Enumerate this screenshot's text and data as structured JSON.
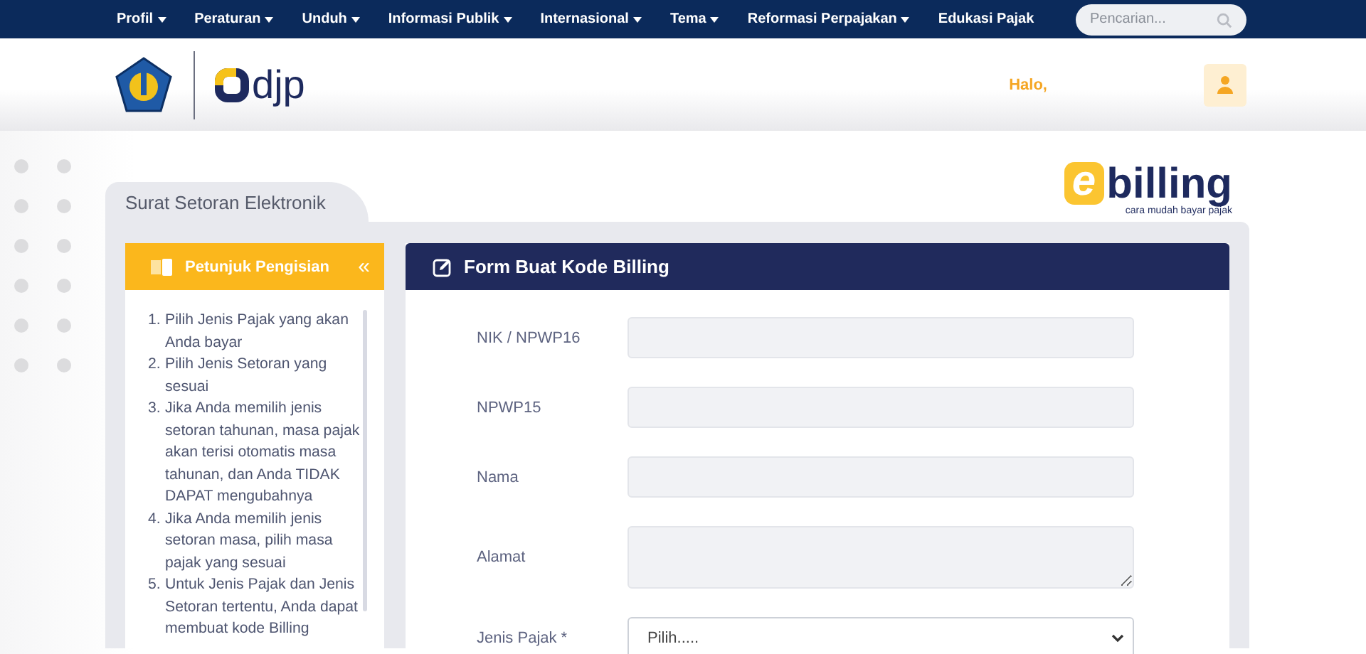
{
  "nav": {
    "items": [
      {
        "label": "Profil",
        "dropdown": true
      },
      {
        "label": "Peraturan",
        "dropdown": true
      },
      {
        "label": "Unduh",
        "dropdown": true
      },
      {
        "label": "Informasi Publik",
        "dropdown": true
      },
      {
        "label": "Internasional",
        "dropdown": true
      },
      {
        "label": "Tema",
        "dropdown": true
      },
      {
        "label": "Reformasi Perpajakan",
        "dropdown": true
      },
      {
        "label": "Edukasi Pajak",
        "dropdown": false
      }
    ],
    "search": {
      "placeholder": "Pencarian..."
    }
  },
  "header": {
    "logo_text": "djp",
    "greeting": "Halo,"
  },
  "ebilling_logo": {
    "letter": "e",
    "word": "billing",
    "tagline": "cara mudah bayar pajak"
  },
  "page_tab": "Surat Setoran Elektronik",
  "guide": {
    "title": "Petunjuk Pengisian",
    "collapse": "«",
    "steps": [
      {
        "number": "1.",
        "text": "Pilih Jenis Pajak yang akan Anda bayar"
      },
      {
        "number": "2.",
        "text": "Pilih Jenis Setoran yang sesuai"
      },
      {
        "number": "3.",
        "text": "Jika Anda memilih jenis setoran tahunan, masa pajak akan terisi otomatis masa tahunan, dan Anda TIDAK DAPAT mengubahnya"
      },
      {
        "number": "4.",
        "text": "Jika Anda memilih jenis setoran masa, pilih masa pajak yang sesuai"
      },
      {
        "number": "5.",
        "text": "Untuk Jenis Pajak dan Jenis Setoran tertentu, Anda dapat membuat kode Billing"
      }
    ]
  },
  "form": {
    "title": "Form Buat Kode Billing",
    "fields": [
      {
        "label": "NIK / NPWP16",
        "kind": "input",
        "disabled": true
      },
      {
        "label": "NPWP15",
        "kind": "input",
        "disabled": true
      },
      {
        "label": "Nama",
        "kind": "input",
        "disabled": true
      },
      {
        "label": "Alamat",
        "kind": "textarea",
        "disabled": true
      },
      {
        "label": "Jenis Pajak *",
        "kind": "select",
        "disabled": false,
        "value": "Pilih....."
      }
    ]
  }
}
